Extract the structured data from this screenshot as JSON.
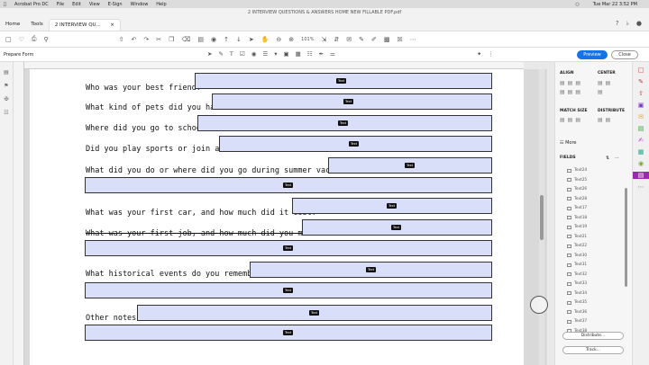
{
  "macbar": {
    "menus": [
      "Acrobat Pro DC",
      "File",
      "Edit",
      "View",
      "E-Sign",
      "Window",
      "Help"
    ],
    "clock": "Tue Mar 22 3:52 PM"
  },
  "window": {
    "title": "2 INTERVIEW QUESTIONS & ANSWERS HOME NEW FILLABLE PDF.pdf"
  },
  "tabs": {
    "home": "Home",
    "tools": "Tools",
    "document": "2 INTERVIEW QU..."
  },
  "toolbar": {
    "zoom": "101%"
  },
  "formbar": {
    "label": "Prepare Form",
    "preview": "Preview",
    "close": "Close"
  },
  "questions": [
    "Who was your best friend?",
    "What kind of pets did you have?",
    "Where did you go to school?",
    "Did you play sports or join a club?",
    "What did you do or where did you go during summer vacation?",
    "What was your first car, and how much did it cost?",
    "What was your first job, and how much did you make?",
    "What historical events do you remember?",
    "Other notes:"
  ],
  "field_tag": "Text",
  "panel": {
    "align": "ALIGN",
    "center": "CENTER",
    "match_size": "MATCH SIZE",
    "distribute": "DISTRIBUTE",
    "more": "More",
    "fields": "FIELDS",
    "field_list": [
      "Text24",
      "Text25",
      "Text26",
      "Text28",
      "Text17",
      "Text18",
      "Text19",
      "Text21",
      "Text22",
      "Text30",
      "Text31",
      "Text32",
      "Text33",
      "Text34",
      "Text35",
      "Text36",
      "Text37",
      "Text38"
    ],
    "distribute_btn": "Distribute...",
    "track_btn": "Track..."
  }
}
